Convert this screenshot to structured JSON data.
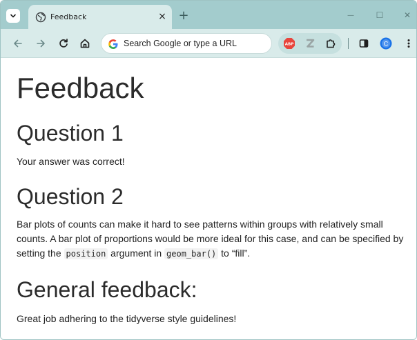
{
  "browser": {
    "tab": {
      "title": "Feedback",
      "close_glyph": "×"
    },
    "new_tab_glyph": "+",
    "window_controls": {
      "minimize": "—",
      "maximize": "☐",
      "close": "✕"
    },
    "omnibox": {
      "placeholder": "Search Google or type a URL"
    },
    "profile_initial": "C",
    "icons": {
      "tab_search": "chevron-down-icon",
      "favicon": "globe-icon",
      "back": "back-arrow-icon",
      "forward": "forward-arrow-icon",
      "reload": "reload-icon",
      "home": "home-icon",
      "google": "google-g-icon",
      "adblock": "adblock-plus-icon",
      "zotero": "zotero-icon",
      "extensions": "puzzle-icon",
      "side_panel": "side-panel-icon",
      "menu": "more-vert-icon"
    },
    "colors": {
      "frame": "#a3cccd",
      "toolbar": "#d9ebea",
      "profile": "#1a73e8",
      "adblock": "#e8453c"
    }
  },
  "page": {
    "title": "Feedback",
    "q1": {
      "heading": "Question 1",
      "body": "Your answer was correct!"
    },
    "q2": {
      "heading": "Question 2",
      "body_part1": "Bar plots of counts can make it hard to see patterns within groups with relatively small counts. A bar plot of proportions would be more ideal for this case, and can be specified by setting the ",
      "code1": "position",
      "body_part2": " argument in ",
      "code2": "geom_bar()",
      "body_part3": " to “fill”."
    },
    "general": {
      "heading": "General feedback:",
      "body": "Great job adhering to the tidyverse style guidelines!"
    }
  }
}
